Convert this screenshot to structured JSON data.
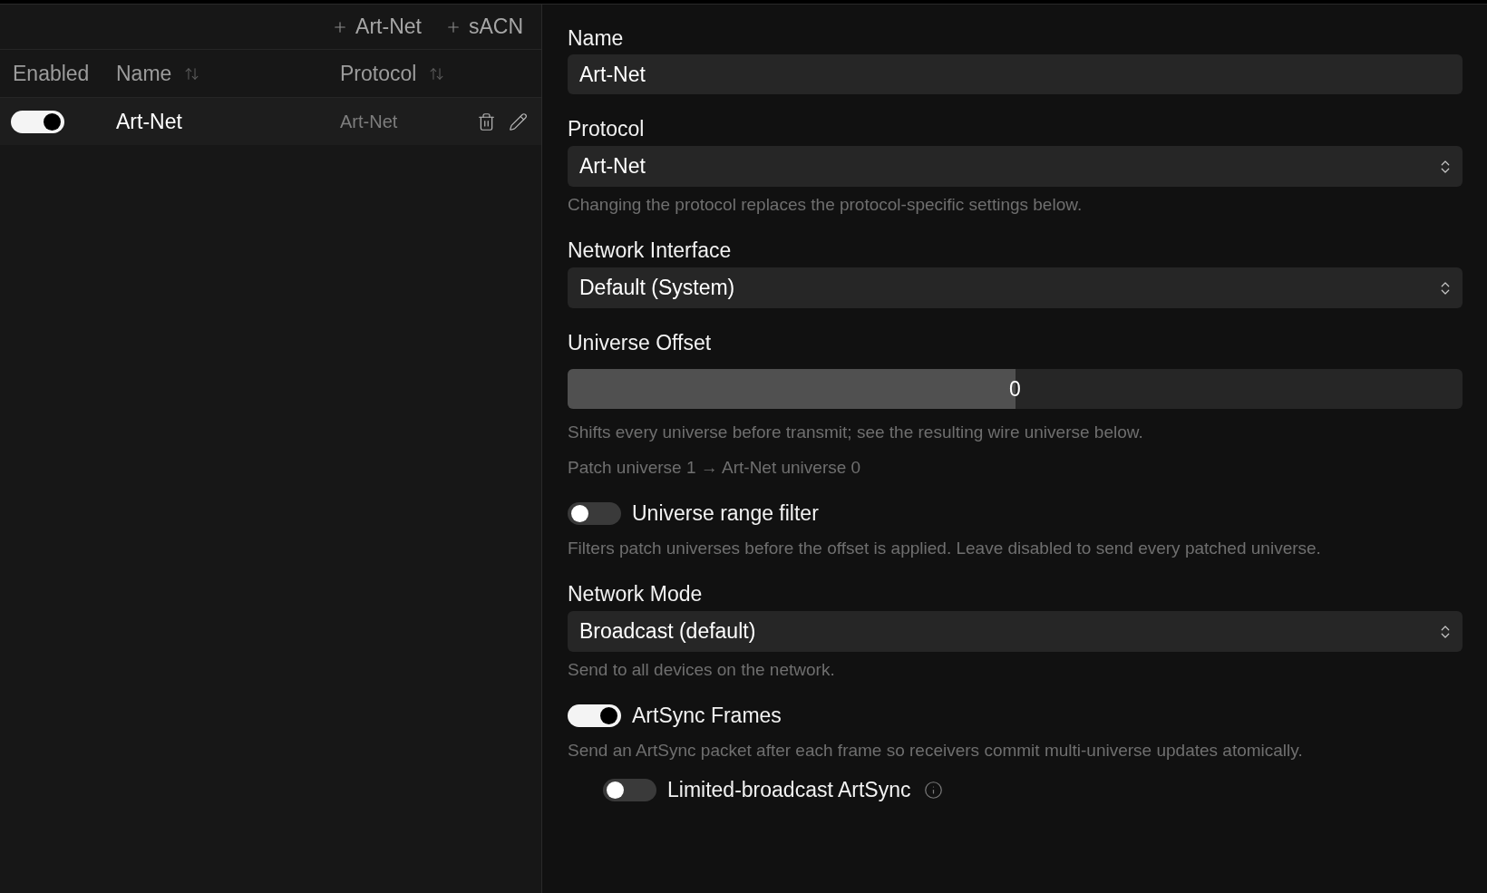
{
  "toolbar": {
    "buttons": [
      {
        "label": "Art-Net"
      },
      {
        "label": "sACN"
      }
    ]
  },
  "table": {
    "columns": [
      {
        "label": "Enabled",
        "sortable": false
      },
      {
        "label": "Name",
        "sortable": true
      },
      {
        "label": "Protocol",
        "sortable": true
      }
    ],
    "rows": [
      {
        "enabled": true,
        "name": "Art-Net",
        "protocol": "Art-Net"
      }
    ]
  },
  "form": {
    "fields": [
      {
        "kind": "text",
        "label": "Name",
        "value": "Art-Net"
      },
      {
        "kind": "select",
        "label": "Protocol",
        "value": "Art-Net",
        "help": [
          "Changing the protocol replaces the protocol-specific settings below."
        ]
      },
      {
        "kind": "select",
        "label": "Network Interface",
        "value": "Default (System)"
      },
      {
        "kind": "slider",
        "label": "Universe Offset",
        "value": "0",
        "level": 0.5,
        "help": [
          "Shifts every universe before transmit; see the resulting wire universe below.",
          "Patch universe 1 → Art-Net universe 0"
        ]
      },
      {
        "kind": "toggle",
        "label": "Universe range filter",
        "on": false,
        "help": [
          "Filters patch universes before the offset is applied. Leave disabled to send every patched universe."
        ]
      },
      {
        "kind": "select",
        "label": "Network Mode",
        "value": "Broadcast (default)",
        "help": [
          "Send to all devices on the network."
        ]
      },
      {
        "kind": "toggle",
        "label": "ArtSync Frames",
        "on": true,
        "help": [
          "Send an ArtSync packet after each frame so receivers commit multi-universe updates atomically."
        ],
        "children": [
          {
            "kind": "toggle",
            "label": "Limited-broadcast ArtSync",
            "on": false,
            "info": true
          }
        ]
      }
    ]
  }
}
